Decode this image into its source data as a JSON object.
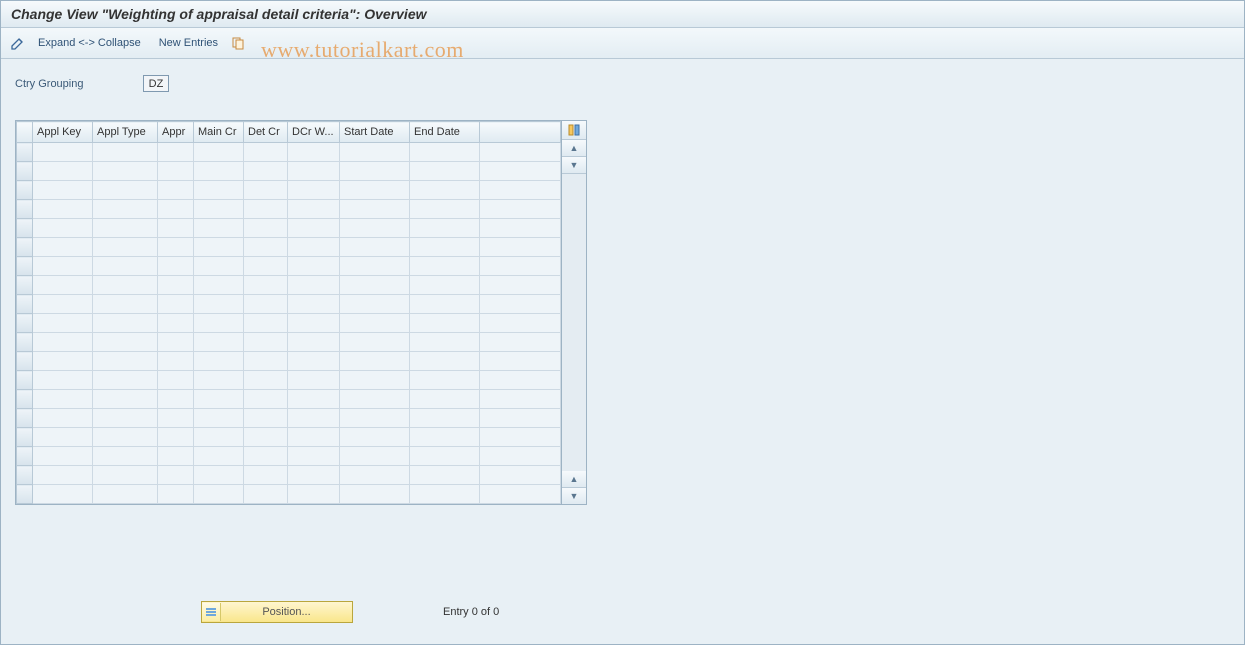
{
  "header": {
    "title": "Change View \"Weighting of appraisal detail criteria\": Overview"
  },
  "toolbar": {
    "expand_collapse": "Expand <-> Collapse",
    "new_entries": "New Entries"
  },
  "fields": {
    "ctry_grouping": {
      "label": "Ctry Grouping",
      "value": "DZ"
    }
  },
  "table": {
    "columns": [
      "Appl Key",
      "Appl Type",
      "Appr",
      "Main Cr",
      "Det Cr",
      "DCr W...",
      "Start Date",
      "End Date"
    ],
    "rows": []
  },
  "footer": {
    "position_label": "Position...",
    "entry_text": "Entry 0 of 0"
  },
  "watermark": "www.tutorialkart.com"
}
